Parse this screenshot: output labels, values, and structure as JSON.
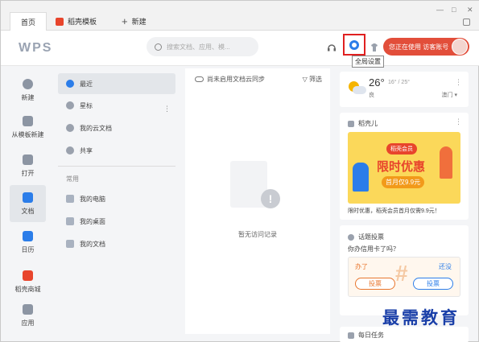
{
  "tabs": {
    "home": "首页",
    "template": "稻壳模板",
    "new": "新建"
  },
  "window_controls": {
    "min": "—",
    "max": "□",
    "close": "✕"
  },
  "header": {
    "logo": "WPS",
    "search_placeholder": "搜索文档、应用、模...",
    "settings_tooltip": "全局设置",
    "account_label": "您正在使用 访客账号"
  },
  "rail": [
    {
      "label": "新建",
      "icon": "plus-circle-icon"
    },
    {
      "label": "从模板新建",
      "icon": "template-icon"
    },
    {
      "label": "打开",
      "icon": "folder-icon"
    },
    {
      "label": "文档",
      "icon": "document-icon"
    },
    {
      "label": "日历",
      "icon": "calendar-icon"
    },
    {
      "label": "稻壳商城",
      "icon": "store-icon"
    },
    {
      "label": "应用",
      "icon": "apps-grid-icon"
    }
  ],
  "nav": {
    "items": [
      {
        "label": "最近",
        "icon": "clock-icon"
      },
      {
        "label": "星标",
        "icon": "star-icon"
      },
      {
        "label": "我的云文档",
        "icon": "cloud-doc-icon"
      },
      {
        "label": "共享",
        "icon": "share-icon"
      }
    ],
    "common_header": "常用",
    "common": [
      {
        "label": "我的电脑",
        "icon": "computer-icon"
      },
      {
        "label": "我的桌面",
        "icon": "desktop-icon"
      },
      {
        "label": "我的文档",
        "icon": "folder-doc-icon"
      }
    ]
  },
  "main": {
    "sync_text": "尚未启用文档云同步",
    "filter_label": "筛选",
    "empty_text": "暂无访问记录",
    "empty_badge": "!"
  },
  "weather": {
    "temp": "26°",
    "range": "16° / 25°",
    "air_quality": "良",
    "city": "澳门"
  },
  "promo": {
    "title": "稻壳儿",
    "tag": "稻壳会员",
    "headline": "限时优惠",
    "price": "首月仅9.9元",
    "caption": "限时优惠，稻壳会员首月仅需9.9元！"
  },
  "vote": {
    "title": "话题投票",
    "question": "你办信用卡了吗？",
    "option_a": "办了",
    "option_b": "还没",
    "middle": "#",
    "button": "投票"
  },
  "tasks": {
    "title": "每日任务"
  },
  "watermark": "最需教育",
  "colors": {
    "accent_blue": "#2b7de9",
    "accent_red": "#e8452c",
    "account_bg": "#e24e3a"
  }
}
